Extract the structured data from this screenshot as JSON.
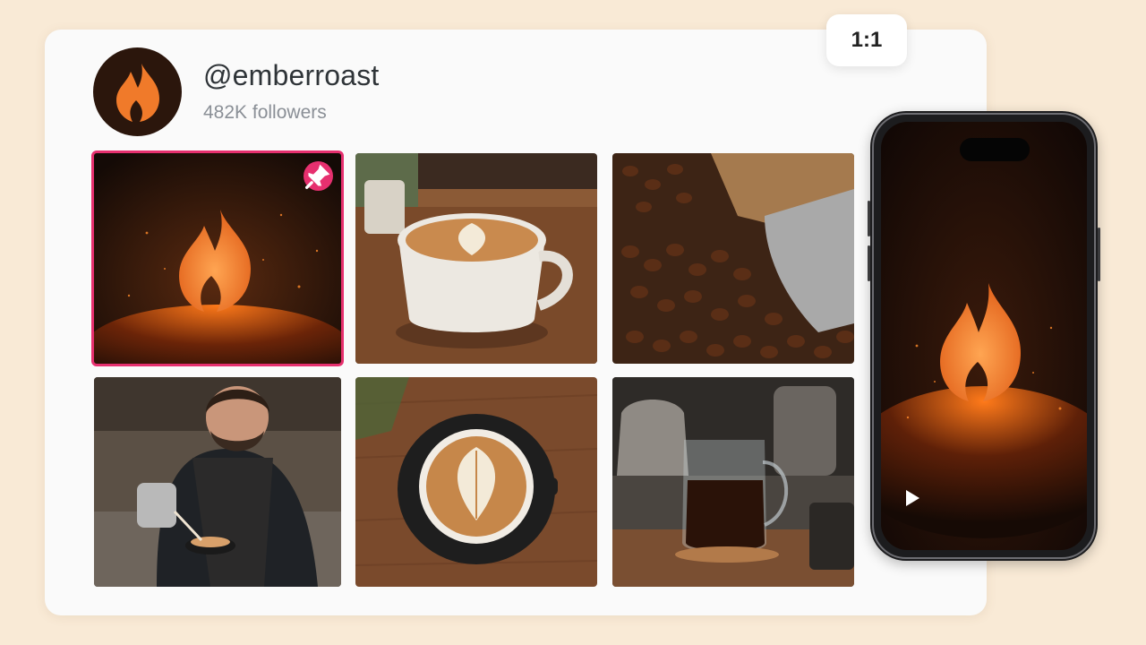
{
  "profile": {
    "handle": "@emberroast",
    "followers": "482K followers",
    "avatar_icon": "flame-icon"
  },
  "aspect_ratio_label": "1:1",
  "colors": {
    "background": "#f9ead6",
    "card": "#fafafa",
    "pin_accent": "#e6306f",
    "flame_orange": "#f07a2a",
    "avatar_bg": "#2b160c"
  },
  "grid": {
    "posts": [
      {
        "subject": "ember-flame-logo",
        "pinned": true,
        "icon": "pin-icon"
      },
      {
        "subject": "latte-art-cup-side",
        "pinned": false
      },
      {
        "subject": "coffee-beans-scoop",
        "pinned": false
      },
      {
        "subject": "barista-pouring-milk",
        "pinned": false
      },
      {
        "subject": "latte-art-top-view",
        "pinned": false
      },
      {
        "subject": "pour-over-carafe",
        "pinned": false
      }
    ]
  },
  "phone_preview": {
    "subject": "ember-flame-logo",
    "play_icon": "play-icon"
  }
}
